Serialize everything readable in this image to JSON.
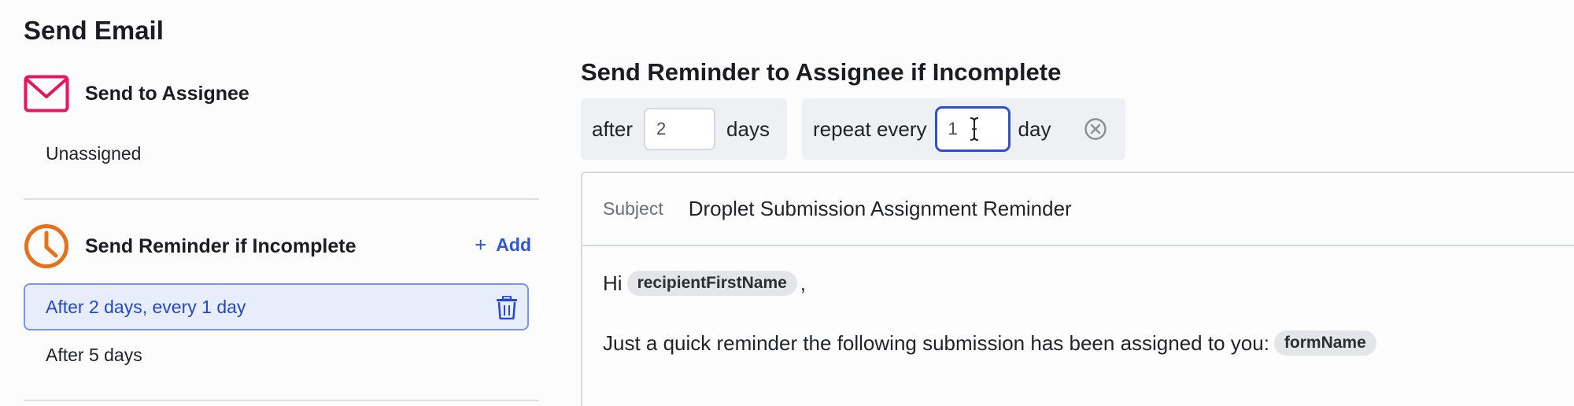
{
  "page": {
    "title": "Send Email"
  },
  "left": {
    "send_to_assignee": {
      "label": "Send to Assignee",
      "icon": "mail-icon",
      "icon_color": "#e5155e",
      "value": "Unassigned"
    },
    "reminder": {
      "label": "Send Reminder if Incomplete",
      "icon": "clock-icon",
      "icon_color": "#e8701a",
      "add_label": "Add",
      "items": [
        {
          "label": "After 2 days, every 1 day",
          "selected": true
        },
        {
          "label": "After 5 days",
          "selected": false
        }
      ]
    }
  },
  "right": {
    "title": "Send Reminder to Assignee if Incomplete",
    "after": {
      "prefix": "after",
      "value": "2",
      "suffix": "days"
    },
    "repeat": {
      "prefix": "repeat every",
      "value": "1",
      "suffix": "day"
    },
    "subject": {
      "label": "Subject",
      "value": "Droplet Submission Assignment Reminder"
    },
    "body": {
      "greeting": "Hi",
      "recipient_tag": "recipientFirstName",
      "comma": ",",
      "line2": "Just a quick reminder the following submission has been assigned to you:",
      "form_tag": "formName"
    }
  },
  "colors": {
    "accent": "#2e56d6",
    "selected_bg": "#e8edfb",
    "selected_border": "#7b95e4"
  }
}
